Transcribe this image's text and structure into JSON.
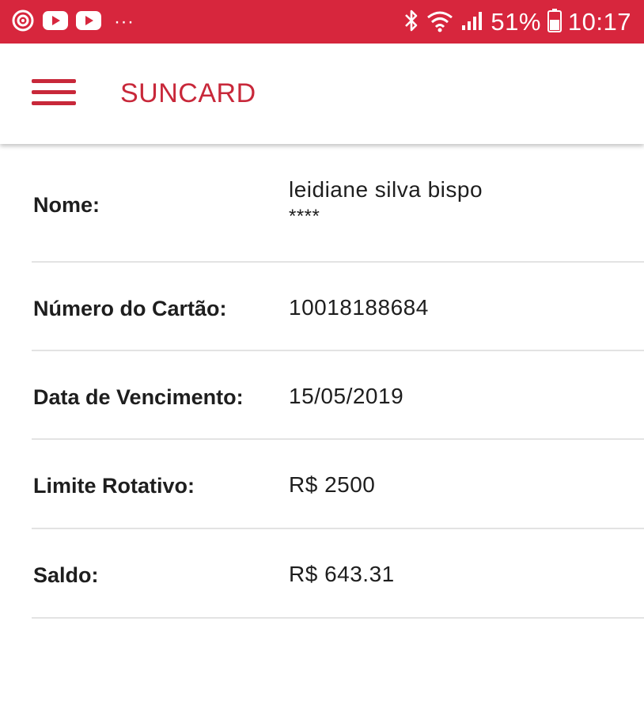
{
  "status_bar": {
    "battery": "51%",
    "time": "10:17",
    "more": "···"
  },
  "app_bar": {
    "title": "SUNCARD"
  },
  "details": [
    {
      "label": "Nome:",
      "value": "leidiane silva bispo",
      "value2": "****"
    },
    {
      "label": "Número do Cartão:",
      "value": "10018188684"
    },
    {
      "label": "Data de Vencimento:",
      "value": "15/05/2019"
    },
    {
      "label": "Limite Rotativo:",
      "value": "R$ 2500"
    },
    {
      "label": "Saldo:",
      "value": "R$ 643.31"
    }
  ],
  "colors": {
    "status_bar": "#d7263d",
    "accent": "#c8283a"
  }
}
